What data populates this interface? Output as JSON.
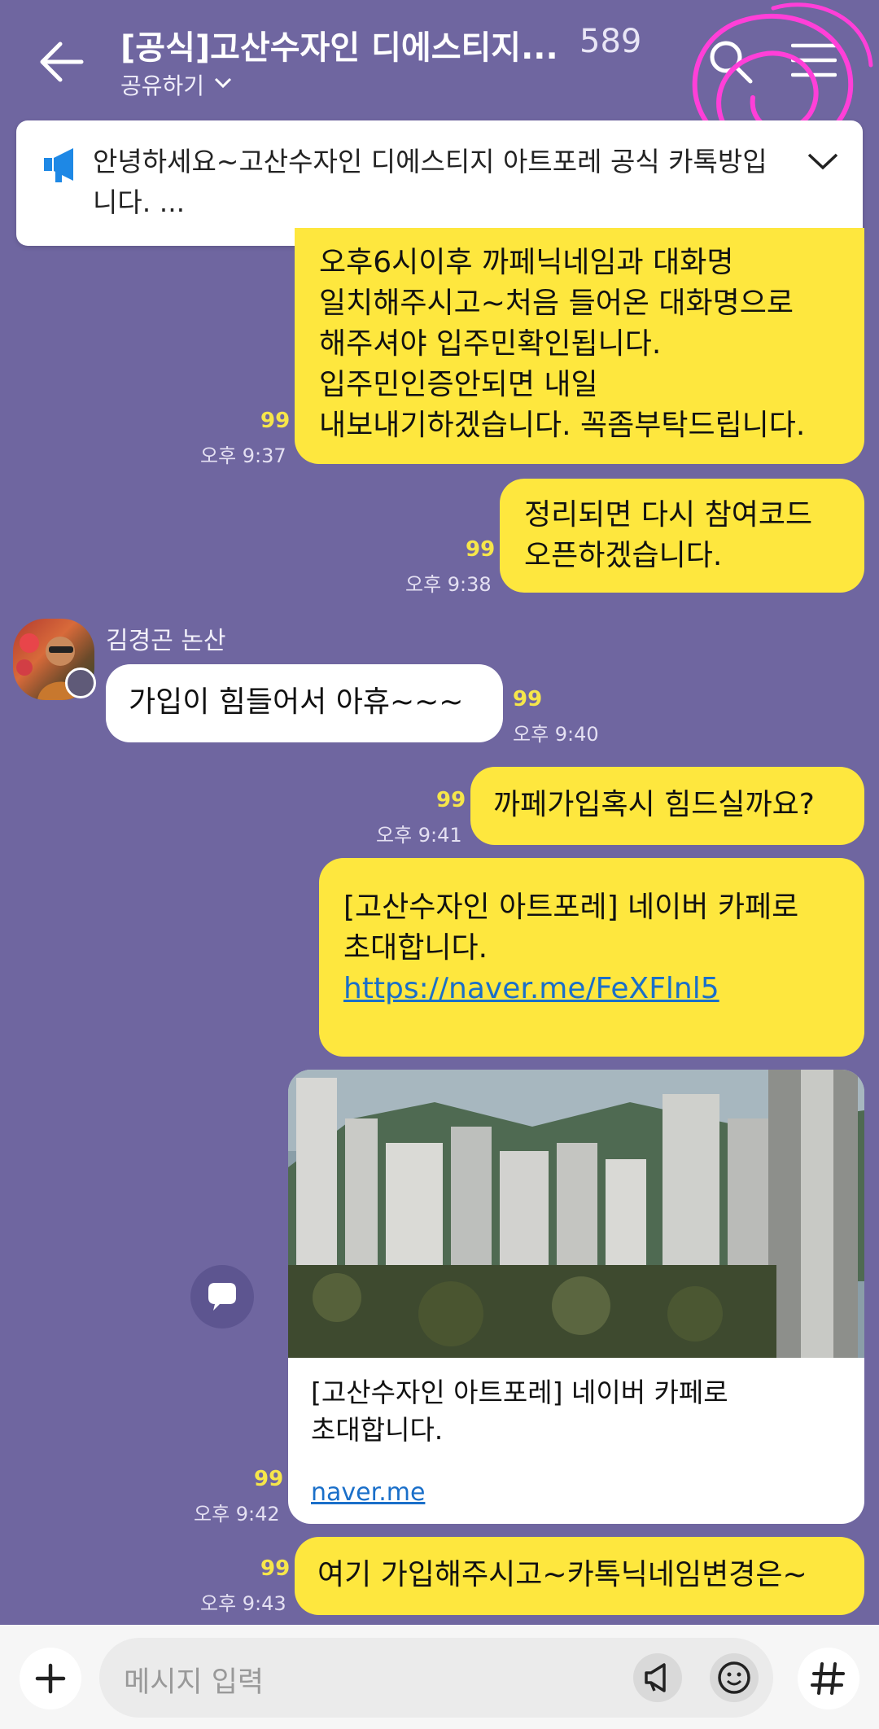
{
  "header": {
    "title": "[공식]고산수자인 디에스티지...",
    "member_count": "589",
    "share_label": "공유하기"
  },
  "notice": {
    "text": "안녕하세요~고산수자인 디에스티지 아트포레 공식 카톡방입니다. ..."
  },
  "messages": [
    {
      "lines": [
        "오후6시이후 까페닉네임과 대화명",
        "일치해주시고~처음 들어온 대화명으로",
        "해주셔야 입주민확인됩니다.",
        "입주민인증안되면 내일",
        "내보내기하겠습니다. 꼭좀부탁드립니다."
      ],
      "read": "99",
      "time": "오후 9:37"
    },
    {
      "lines": [
        "정리되면 다시 참여코드",
        "오픈하겠습니다."
      ],
      "read": "99",
      "time": "오후 9:38"
    },
    {
      "sender": "김경곤 논산",
      "lines": [
        "가입이 힘들어서 아휴~~~"
      ],
      "read": "99",
      "time": "오후 9:40"
    },
    {
      "lines": [
        "까페가입혹시 힘드실까요?"
      ],
      "read": "99",
      "time": "오후 9:41"
    },
    {
      "lines": [
        "",
        "[고산수자인 아트포레] 네이버 카페로",
        "초대합니다."
      ],
      "link": "https://naver.me/FeXFlnl5"
    },
    {
      "card_title_lines": [
        "[고산수자인 아트포레] 네이버 카페로",
        "초대합니다."
      ],
      "card_link": "naver.me",
      "read": "99",
      "time": "오후 9:42"
    },
    {
      "lines": [
        "여기 가입해주시고~카톡닉네임변경은~"
      ],
      "read": "99",
      "time": "오후 9:43"
    }
  ],
  "input": {
    "placeholder": "메시지 입력"
  },
  "icons": {
    "back": "arrow-left-icon",
    "search": "search-icon",
    "menu": "hamburger-menu-icon",
    "notice": "megaphone-icon",
    "share": "speech-bubble-icon",
    "plus": "plus-icon",
    "speaker": "megaphone-icon",
    "emoji": "smiley-icon",
    "hash": "hash-icon"
  },
  "colors": {
    "background": "#6f66a0",
    "my_bubble": "#fee73e",
    "other_bubble": "#ffffff",
    "read_count": "#f6e64a",
    "link": "#1a6fc9",
    "annotation": "#ff3fd8"
  }
}
